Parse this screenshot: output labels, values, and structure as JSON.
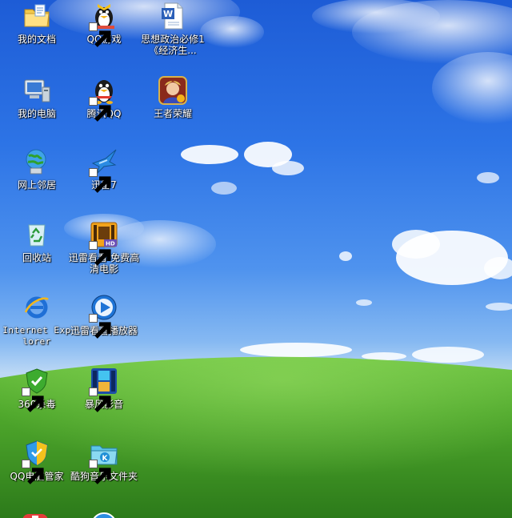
{
  "desktop": {
    "icons": [
      {
        "id": "my-documents",
        "label": "我的文档",
        "icon": "folder-documents-icon",
        "shortcut": false
      },
      {
        "id": "qq-games",
        "label": "QQ游戏",
        "icon": "qq-games-icon",
        "shortcut": true
      },
      {
        "id": "word-doc",
        "label": "思想政治必修1《经济生...",
        "icon": "word-document-icon",
        "shortcut": false
      },
      {
        "id": "my-computer",
        "label": "我的电脑",
        "icon": "computer-icon",
        "shortcut": false
      },
      {
        "id": "tencent-qq",
        "label": "腾讯QQ",
        "icon": "qq-penguin-icon",
        "shortcut": true
      },
      {
        "id": "honor-of-kings",
        "label": "王者荣耀",
        "icon": "game-hero-icon",
        "shortcut": false
      },
      {
        "id": "network-places",
        "label": "网上邻居",
        "icon": "network-globe-icon",
        "shortcut": false
      },
      {
        "id": "xunlei7",
        "label": "迅雷7",
        "icon": "thunder-bird-icon",
        "shortcut": true
      },
      {
        "id": "recycle-bin",
        "label": "回收站",
        "icon": "recycle-bin-icon",
        "shortcut": false
      },
      {
        "id": "xunlei-kankan-hd",
        "label": "迅雷看看-免费高清电影",
        "icon": "film-hd-icon",
        "shortcut": true
      },
      {
        "id": "internet-explorer",
        "label": "Internet Explorer",
        "icon": "internet-explorer-icon",
        "shortcut": false
      },
      {
        "id": "xunlei-kankan-player",
        "label": "迅雷看看播放器",
        "icon": "media-play-icon",
        "shortcut": true
      },
      {
        "id": "360-antivirus",
        "label": "360杀毒",
        "icon": "shield-icon",
        "shortcut": true
      },
      {
        "id": "baofeng",
        "label": "暴风影音",
        "icon": "film-player-icon",
        "shortcut": true
      },
      {
        "id": "qq-pc-manager",
        "label": "QQ电脑管家",
        "icon": "shield-manager-icon",
        "shortcut": true
      },
      {
        "id": "kugou-folder",
        "label": "酷狗音乐文件夹",
        "icon": "kugou-folder-icon",
        "shortcut": true
      }
    ],
    "partial_icons": [
      "red-app-icon",
      "blue-app-icon"
    ]
  },
  "colors": {
    "sky_top": "#1d5cd6",
    "sky_bottom": "#bcd8f5",
    "hill_top": "#5fb93a",
    "hill_bottom": "#2f7d1c",
    "label_text": "#ffffff"
  }
}
